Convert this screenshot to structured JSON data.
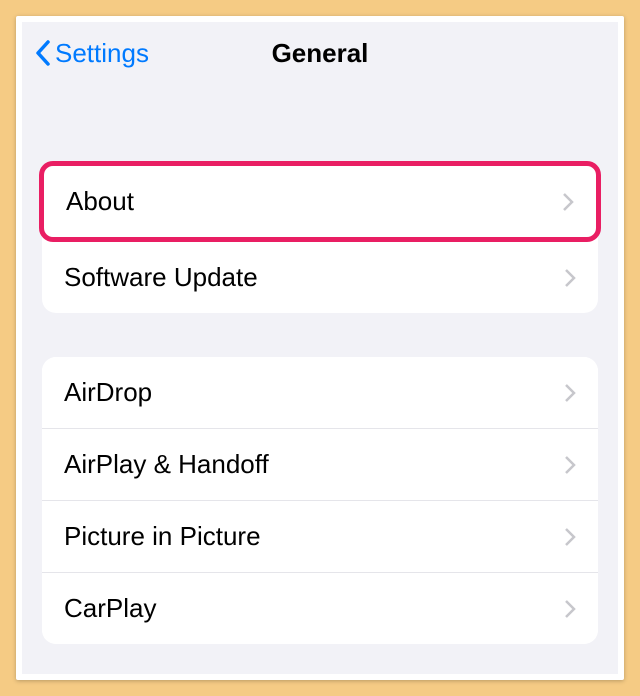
{
  "nav": {
    "back_label": "Settings",
    "title": "General"
  },
  "groups": [
    {
      "items": [
        {
          "label": "About",
          "highlighted": true
        },
        {
          "label": "Software Update",
          "highlighted": false
        }
      ]
    },
    {
      "items": [
        {
          "label": "AirDrop",
          "highlighted": false
        },
        {
          "label": "AirPlay & Handoff",
          "highlighted": false
        },
        {
          "label": "Picture in Picture",
          "highlighted": false
        },
        {
          "label": "CarPlay",
          "highlighted": false
        }
      ]
    }
  ]
}
